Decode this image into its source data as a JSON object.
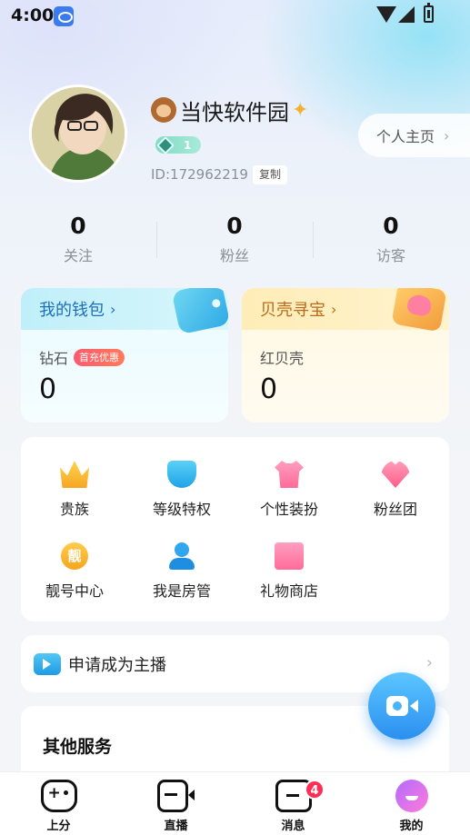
{
  "status_bar": {
    "time": "4:00"
  },
  "profile": {
    "username": "当快软件园",
    "level": "1",
    "user_id": "ID:172962219",
    "copy_label": "复制",
    "homepage_label": "个人主页"
  },
  "stats": [
    {
      "value": "0",
      "label": "关注"
    },
    {
      "value": "0",
      "label": "粉丝"
    },
    {
      "value": "0",
      "label": "访客"
    }
  ],
  "wallet": {
    "title": "我的钱包",
    "label": "钻石",
    "badge": "首充优惠",
    "value": "0"
  },
  "shell": {
    "title": "贝壳寻宝",
    "label": "红贝壳",
    "value": "0"
  },
  "features": [
    {
      "label": "贵族",
      "icon": "crown-icon"
    },
    {
      "label": "等级特权",
      "icon": "shield-icon"
    },
    {
      "label": "个性装扮",
      "icon": "outfit-icon"
    },
    {
      "label": "粉丝团",
      "icon": "heart-icon"
    },
    {
      "label": "靓号中心",
      "icon": "pretty-number-icon",
      "glyph": "靓"
    },
    {
      "label": "我是房管",
      "icon": "room-manager-icon"
    },
    {
      "label": "礼物商店",
      "icon": "gift-shop-icon"
    }
  ],
  "apply": {
    "label": "申请成为主播"
  },
  "other_services": {
    "title": "其他服务"
  },
  "bottom_nav": {
    "items": [
      {
        "label": "上分",
        "icon": "gamepad-icon"
      },
      {
        "label": "直播",
        "icon": "live-camera-icon"
      },
      {
        "label": "消息",
        "icon": "message-icon",
        "badge": "4"
      },
      {
        "label": "我的",
        "icon": "profile-icon"
      }
    ]
  },
  "colors": {
    "accent_blue": "#2a8ff0",
    "wallet_title": "#1f6fb8",
    "shell_title": "#b86a18",
    "badge_red": "#ff2e55"
  }
}
